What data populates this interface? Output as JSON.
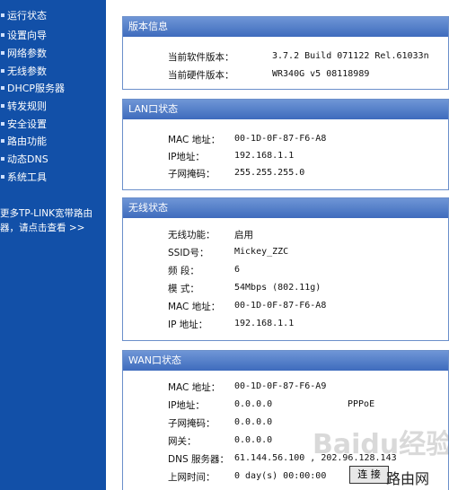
{
  "sidebar": {
    "items": [
      {
        "label": "运行状态"
      },
      {
        "label": "设置向导"
      },
      {
        "label": "网络参数"
      },
      {
        "label": "无线参数"
      },
      {
        "label": "DHCP服务器"
      },
      {
        "label": "转发规则"
      },
      {
        "label": "安全设置"
      },
      {
        "label": "路由功能"
      },
      {
        "label": "动态DNS"
      },
      {
        "label": "系统工具"
      }
    ],
    "promo_line1": "更多TP-LINK宽带路由",
    "promo_line2": "器，请点击查看 >>"
  },
  "version": {
    "title": "版本信息",
    "software_label": "当前软件版本：",
    "software_value": "3.7.2 Build 071122 Rel.61033n",
    "hardware_label": "当前硬件版本：",
    "hardware_value": "WR340G v5 08118989"
  },
  "lan": {
    "title": "LAN口状态",
    "mac_label": "MAC 地址：",
    "mac_value": "00-1D-0F-87-F6-A8",
    "ip_label": "IP地址：",
    "ip_value": "192.168.1.1",
    "mask_label": "子网掩码：",
    "mask_value": "255.255.255.0"
  },
  "wireless": {
    "title": "无线状态",
    "func_label": "无线功能：",
    "func_value": "启用",
    "ssid_label": "SSID号：",
    "ssid_value": "Mickey_ZZC",
    "channel_label": "频 段：",
    "channel_value": "6",
    "mode_label": "模 式：",
    "mode_value": "54Mbps (802.11g)",
    "mac_label": "MAC 地址：",
    "mac_value": "00-1D-0F-87-F6-A8",
    "ip_label": "IP 地址：",
    "ip_value": "192.168.1.1"
  },
  "wan": {
    "title": "WAN口状态",
    "mac_label": "MAC 地址：",
    "mac_value": "00-1D-0F-87-F6-A9",
    "ip_label": "IP地址：",
    "ip_value": "0.0.0.0",
    "conn_type": "PPPoE",
    "mask_label": "子网掩码：",
    "mask_value": "0.0.0.0",
    "gateway_label": "网关：",
    "gateway_value": "0.0.0.0",
    "dns_label": "DNS 服务器：",
    "dns_value": "61.144.56.100 , 202.96.128.143",
    "uptime_label": "上网时间：",
    "uptime_value": "0 day(s) 00:00:00",
    "connect_label": "连 接"
  },
  "watermark": {
    "text": "Baidu经验",
    "text2": "路由网"
  }
}
